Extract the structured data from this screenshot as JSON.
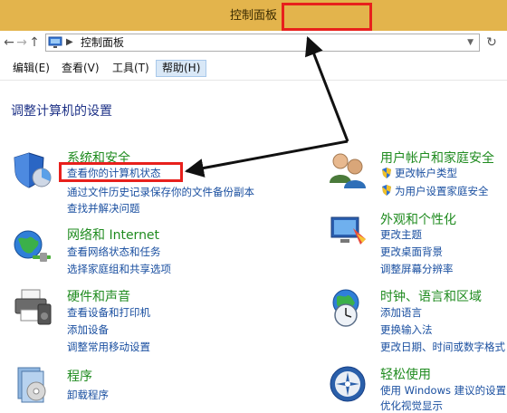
{
  "window": {
    "title": "控制面板"
  },
  "addressbar": {
    "back": "←",
    "forward": "→",
    "up": "↑",
    "breadcrumb": "控制面板",
    "refresh": "↻"
  },
  "menu": [
    "编辑(E)",
    "查看(V)",
    "工具(T)",
    "帮助(H)"
  ],
  "main": {
    "heading": "调整计算机的设置",
    "categories": [
      {
        "title": "系统和安全",
        "links": [
          "查看你的计算机状态",
          "通过文件历史记录保存你的文件备份副本",
          "查找并解决问题"
        ]
      },
      {
        "title": "网络和 Internet",
        "links": [
          "查看网络状态和任务",
          "选择家庭组和共享选项"
        ]
      },
      {
        "title": "硬件和声音",
        "links": [
          "查看设备和打印机",
          "添加设备",
          "调整常用移动设置"
        ]
      },
      {
        "title": "程序",
        "links": [
          "卸载程序"
        ]
      },
      {
        "title": "用户帐户和家庭安全",
        "links": [
          "更改帐户类型",
          "为用户设置家庭安全"
        ]
      },
      {
        "title": "外观和个性化",
        "links": [
          "更改主题",
          "更改桌面背景",
          "调整屏幕分辨率"
        ]
      },
      {
        "title": "时钟、语言和区域",
        "links": [
          "添加语言",
          "更换输入法",
          "更改日期、时间或数字格式"
        ]
      },
      {
        "title": "轻松使用",
        "links": [
          "使用 Windows 建议的设置",
          "优化视觉显示"
        ]
      }
    ]
  },
  "colors": {
    "titlebar": "#e3b44c",
    "category_title": "#1f8b1f",
    "link": "#1a4fa0",
    "heading": "#1e3287",
    "annotation": "#e8201c"
  }
}
